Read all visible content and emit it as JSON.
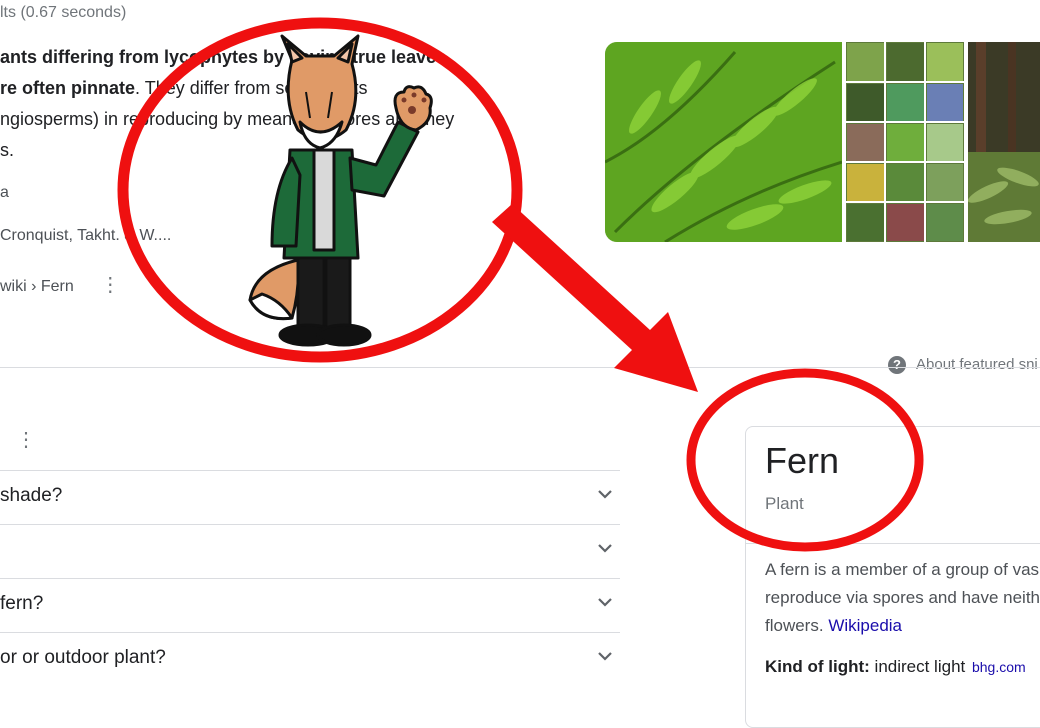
{
  "results": {
    "stats": "lts (0.67 seconds)",
    "snippet_line1_bold": "ants differing from lycophytes by having true leaves",
    "snippet_line2_bold": "re often pinnate",
    "snippet_line2_rest": ". They differ from seed plants",
    "snippet_line3": "ngiosperms) in reproducing by means of spores and they",
    "snippet_line4": "s.",
    "meta1": "a",
    "meta2": "Cronquist, Takht. & W....",
    "cite": "wiki › Fern",
    "more_icon": "⋮"
  },
  "about_snippet": "About featured sni",
  "paa": {
    "more_icon": "⋮",
    "questions": [
      "shade?",
      "",
      "fern?",
      "or or outdoor plant?"
    ]
  },
  "knowledge_panel": {
    "title": "Fern",
    "subtitle": "Plant",
    "desc_line1": "A fern is a member of a group of vas",
    "desc_line2": "reproduce via spores and have neith",
    "desc_line3": "flowers.",
    "desc_link": "Wikipedia",
    "fact_label": "Kind of light:",
    "fact_value": " indirect light",
    "fact_source": "bhg.com"
  },
  "colors": {
    "annotation_red": "#ef1010",
    "fox_fur": "#e09a67",
    "jacket": "#1d6a39"
  },
  "icons": [
    "help-icon",
    "chevron-down-icon",
    "more-vert-icon",
    "arrow-annotation",
    "circle-annotation"
  ]
}
